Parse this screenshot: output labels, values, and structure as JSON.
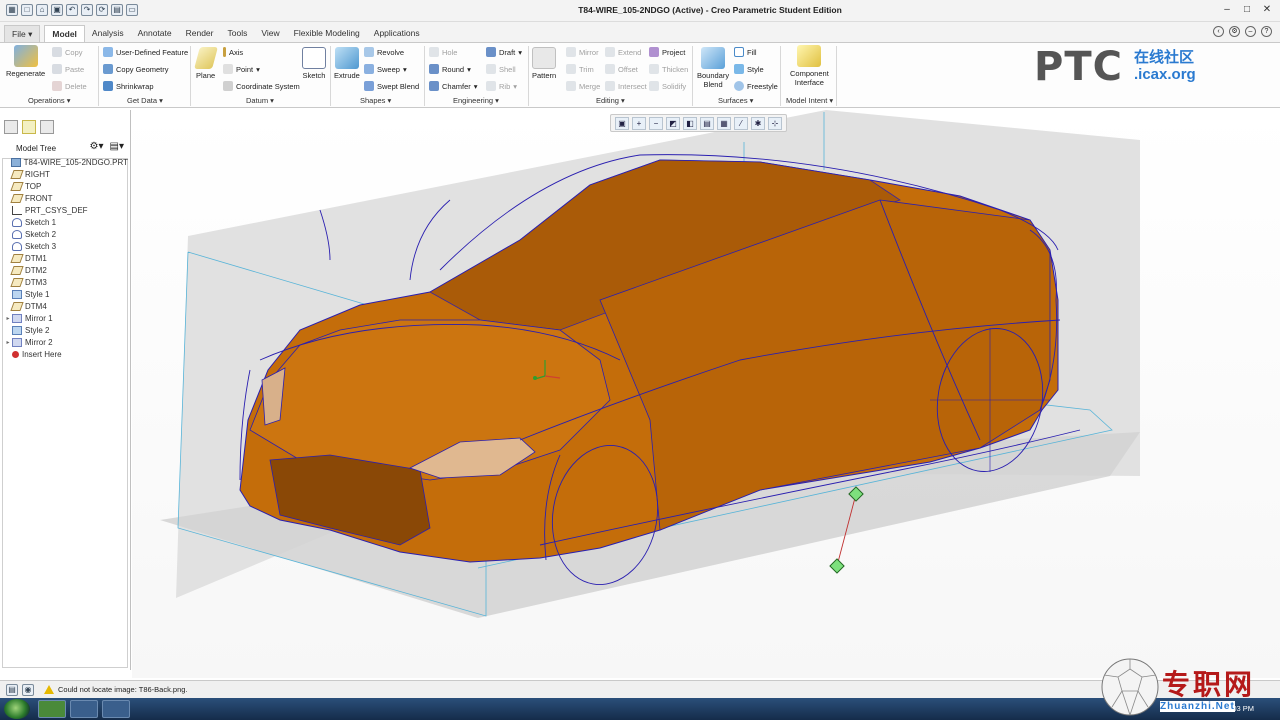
{
  "window": {
    "title": "T84-WIRE_105-2NDGO (Active) - Creo Parametric Student Edition"
  },
  "quick_access": [
    "new-icon",
    "open-icon",
    "save-icon",
    "undo-icon",
    "redo-icon",
    "regenerate-icon",
    "windows-icon",
    "close-window-icon"
  ],
  "tabs": [
    {
      "label": "File",
      "name": "tab-file"
    },
    {
      "label": "Model",
      "name": "tab-model",
      "active": true
    },
    {
      "label": "Analysis",
      "name": "tab-analysis"
    },
    {
      "label": "Annotate",
      "name": "tab-annotate"
    },
    {
      "label": "Render",
      "name": "tab-render"
    },
    {
      "label": "Tools",
      "name": "tab-tools"
    },
    {
      "label": "View",
      "name": "tab-view"
    },
    {
      "label": "Flexible Modeling",
      "name": "tab-flexible-modeling"
    },
    {
      "label": "Applications",
      "name": "tab-applications"
    }
  ],
  "file_arrow": "▾",
  "ribbon": {
    "regenerate": "Regenerate",
    "copy": "Copy",
    "paste": "Paste",
    "delete": "Delete",
    "user_defined_feature": "User-Defined Feature",
    "copy_geometry": "Copy Geometry",
    "shrinkwrap": "Shrinkwrap",
    "plane": "Plane",
    "axis": "Axis",
    "point": "Point",
    "coordinate_system": "Coordinate System",
    "sketch": "Sketch",
    "extrude": "Extrude",
    "revolve": "Revolve",
    "sweep": "Sweep",
    "swept_blend": "Swept Blend",
    "hole": "Hole",
    "round": "Round",
    "chamfer": "Chamfer",
    "draft": "Draft",
    "shell": "Shell",
    "rib": "Rib",
    "pattern": "Pattern",
    "mirror": "Mirror",
    "trim": "Trim",
    "merge": "Merge",
    "extend": "Extend",
    "offset": "Offset",
    "intersect": "Intersect",
    "project": "Project",
    "thicken": "Thicken",
    "solidify": "Solidify",
    "boundary_blend_1": "Boundary",
    "boundary_blend_2": "Blend",
    "fill": "Fill",
    "style": "Style",
    "freestyle": "Freestyle",
    "component_interface_1": "Component",
    "component_interface_2": "Interface"
  },
  "groups": [
    {
      "label": "Operations ▾"
    },
    {
      "label": "Get Data ▾"
    },
    {
      "label": "Datum ▾"
    },
    {
      "label": "Shapes ▾"
    },
    {
      "label": "Engineering ▾"
    },
    {
      "label": "Editing ▾"
    },
    {
      "label": "Surfaces ▾"
    },
    {
      "label": "Model Intent ▾"
    }
  ],
  "logo": {
    "brand": "PTC",
    "cn": "在线社区",
    "url": ".icax.org"
  },
  "model_tree": {
    "title": "Model Tree",
    "items": [
      {
        "label": "T84-WIRE_105-2NDGO.PRT",
        "icon": "part-icon",
        "expand": ""
      },
      {
        "label": "RIGHT",
        "icon": "datum-plane-icon",
        "expand": ""
      },
      {
        "label": "TOP",
        "icon": "datum-plane-icon",
        "expand": ""
      },
      {
        "label": "FRONT",
        "icon": "datum-plane-icon",
        "expand": ""
      },
      {
        "label": "PRT_CSYS_DEF",
        "icon": "csys-icon",
        "expand": ""
      },
      {
        "label": "Sketch 1",
        "icon": "sketch-icon",
        "expand": ""
      },
      {
        "label": "Sketch 2",
        "icon": "sketch-icon",
        "expand": ""
      },
      {
        "label": "Sketch 3",
        "icon": "sketch-icon",
        "expand": ""
      },
      {
        "label": "DTM1",
        "icon": "datum-plane-icon",
        "expand": ""
      },
      {
        "label": "DTM2",
        "icon": "datum-plane-icon",
        "expand": ""
      },
      {
        "label": "DTM3",
        "icon": "datum-plane-icon",
        "expand": ""
      },
      {
        "label": "Style 1",
        "icon": "style-icon",
        "expand": ""
      },
      {
        "label": "DTM4",
        "icon": "datum-plane-icon",
        "expand": ""
      },
      {
        "label": "Mirror 1",
        "icon": "mirror-icon",
        "expand": "▸"
      },
      {
        "label": "Style 2",
        "icon": "style-icon",
        "expand": ""
      },
      {
        "label": "Mirror 2",
        "icon": "mirror-icon",
        "expand": "▸"
      },
      {
        "label": "Insert Here",
        "icon": "insert-here-icon",
        "expand": ""
      }
    ]
  },
  "view_toolbar": [
    "refit-icon",
    "zoom-in-icon",
    "zoom-out-icon",
    "repaint-icon",
    "display-style-icon",
    "saved-views-icon",
    "view-manager-icon",
    "datum-display-icon",
    "spin-center-icon",
    "annotation-display-icon"
  ],
  "status": {
    "message": "Could not locate image: T86-Back.png."
  },
  "watermark": {
    "cn": "专职网",
    "url": "Zhuanzhi.Net"
  },
  "clock": "8:03 PM",
  "colors": {
    "body": "#c06a08",
    "wire": "#2a1fb0",
    "plane": "#e0e0e0",
    "datum_edge": "#4ab0d8"
  }
}
